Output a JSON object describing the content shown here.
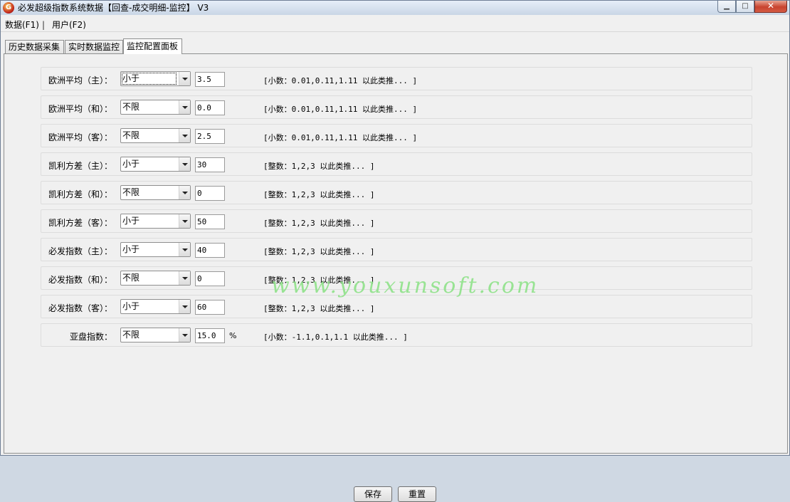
{
  "window": {
    "title": "必发超级指数系统数据【回查-成交明细-监控】 V3",
    "app_icon_glyph": "G",
    "accent_close": "#c8432f"
  },
  "menu": {
    "items": [
      "数据(F1)",
      "用户(F2)"
    ],
    "separator": "|"
  },
  "tabs": [
    {
      "label": "历史数据采集",
      "active": false
    },
    {
      "label": "实时数据监控",
      "active": false
    },
    {
      "label": "监控配置面板",
      "active": true
    }
  ],
  "rows": [
    {
      "label": "欧洲平均（主）：",
      "select": "小于",
      "value": "3.5",
      "suffix": "",
      "hint": "[小数：0.01,0.11,1.11 以此类推... ]"
    },
    {
      "label": "欧洲平均（和）：",
      "select": "不限",
      "value": "0.0",
      "suffix": "",
      "hint": "[小数：0.01,0.11,1.11 以此类推... ]"
    },
    {
      "label": "欧洲平均（客）：",
      "select": "不限",
      "value": "2.5",
      "suffix": "",
      "hint": "[小数：0.01,0.11,1.11 以此类推... ]"
    },
    {
      "label": "凯利方差（主）：",
      "select": "小于",
      "value": "30",
      "suffix": "",
      "hint": "[整数：1,2,3 以此类推... ]"
    },
    {
      "label": "凯利方差（和）：",
      "select": "不限",
      "value": "0",
      "suffix": "",
      "hint": "[整数：1,2,3 以此类推... ]"
    },
    {
      "label": "凯利方差（客）：",
      "select": "小于",
      "value": "50",
      "suffix": "",
      "hint": "[整数：1,2,3 以此类推... ]"
    },
    {
      "label": "必发指数（主）：",
      "select": "小于",
      "value": "40",
      "suffix": "",
      "hint": "[整数：1,2,3 以此类推... ]"
    },
    {
      "label": "必发指数（和）：",
      "select": "不限",
      "value": "0",
      "suffix": "",
      "hint": "[整数：1,2,3 以此类推... ]"
    },
    {
      "label": "必发指数（客）：",
      "select": "小于",
      "value": "60",
      "suffix": "",
      "hint": "[整数：1,2,3 以此类推... ]"
    },
    {
      "label": "亚盘指数：",
      "select": "不限",
      "value": "15.0",
      "suffix": "%",
      "hint": "[小数：-1.1,0.1,1.1 以此类推... ]"
    }
  ],
  "watermark": "www.youxunsoft.com",
  "buttons": {
    "save": "保存",
    "reset": "重置"
  }
}
